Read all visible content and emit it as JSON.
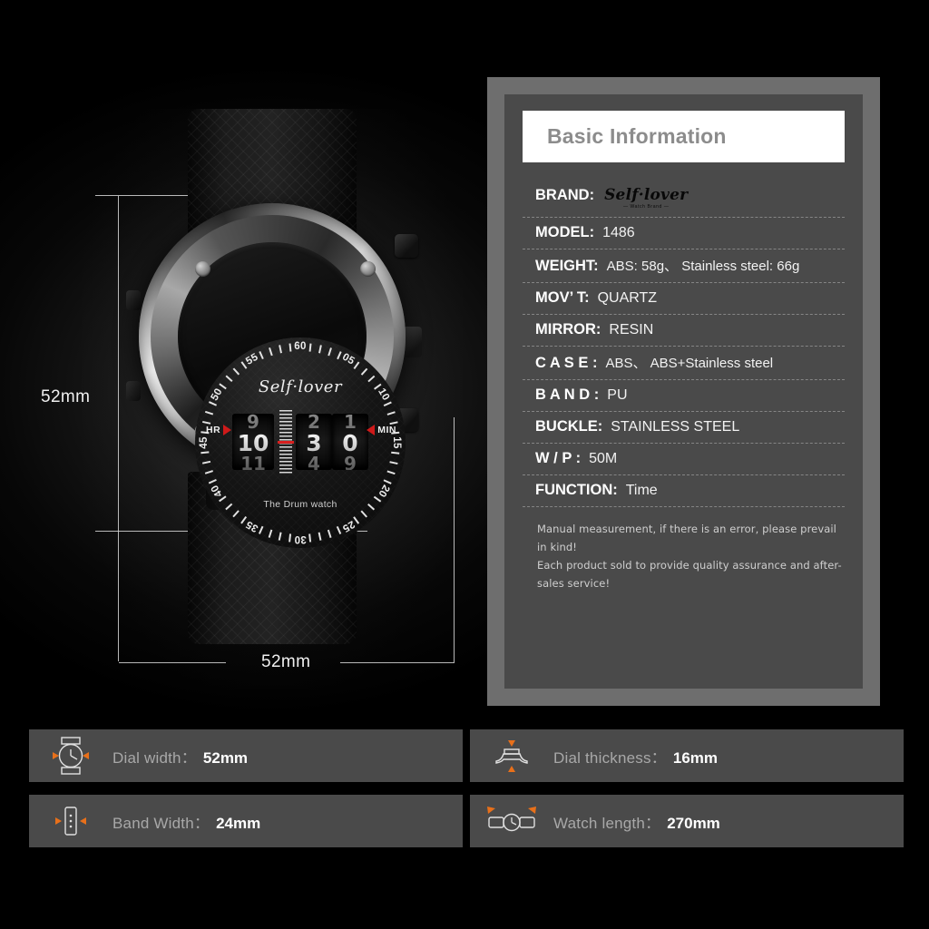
{
  "product": {
    "dial_brand_text": "Self·lover",
    "dial_sub_text": "The Drum watch",
    "hour_marker_label": "HR",
    "minute_marker_label": "MIN",
    "chapter_numbers": [
      "60",
      "05",
      "10",
      "15",
      "20",
      "25",
      "30",
      "35",
      "40",
      "45",
      "50",
      "55"
    ],
    "drum_hour": {
      "up": "9",
      "mid": "10",
      "down": "11"
    },
    "drum_min_tens": {
      "up": "2",
      "mid": "3",
      "down": "4"
    },
    "drum_min_ones": {
      "up": "1",
      "mid": "0",
      "down": "9"
    }
  },
  "dimensions": {
    "vertical_label": "52mm",
    "horizontal_label": "52mm"
  },
  "info": {
    "header_title": "Basic Information",
    "rows": [
      {
        "label": "BRAND:",
        "value": "",
        "logo": {
          "main": "Self·lover",
          "sub": "— Watch Brand —"
        }
      },
      {
        "label": "MODEL:",
        "value": "1486"
      },
      {
        "label": "WEIGHT:",
        "value": "ABS: 58g、  Stainless steel: 66g"
      },
      {
        "label": "MOV’ T:",
        "value": "QUARTZ"
      },
      {
        "label": "MIRROR:",
        "value": "RESIN"
      },
      {
        "label": "C A S E :",
        "value": "ABS、 ABS+Stainless steel"
      },
      {
        "label": "B A N D :",
        "value": "PU"
      },
      {
        "label": "BUCKLE:",
        "value": "STAINLESS STEEL"
      },
      {
        "label": "W / P :",
        "value": "50M"
      },
      {
        "label": "FUNCTION:",
        "value": "Time"
      }
    ],
    "disclaimer_line1": "Manual measurement, if there is an error, please prevail in kind!",
    "disclaimer_line2": "Each product sold to provide quality assurance and after-sales service!"
  },
  "spec_bars": [
    {
      "icon": "watch-face-icon",
      "label": "Dial width：",
      "value": "52mm"
    },
    {
      "icon": "watch-strap-icon",
      "label": "Band Width：",
      "value": "24mm"
    },
    {
      "icon": "watch-profile-icon",
      "label": "Dial thickness：",
      "value": "16mm"
    },
    {
      "icon": "watch-length-icon",
      "label": "Watch length：",
      "value": "270mm"
    }
  ],
  "colors": {
    "accent_orange": "#e8701a",
    "marker_red": "#cf1a1a",
    "panel_frame": "#6e6e6e",
    "panel_inner": "#4a4a4a",
    "header_bg": "#ffffff"
  }
}
